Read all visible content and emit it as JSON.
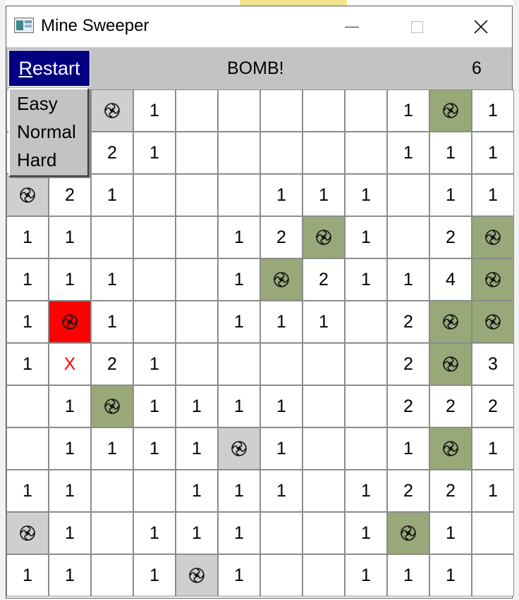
{
  "window": {
    "title": "Mine Sweeper"
  },
  "toolbar": {
    "restart_rest": "estart",
    "restart_accel": "R",
    "status": "BOMB!",
    "counter": "6"
  },
  "menu": {
    "items": [
      "Easy",
      "Normal",
      "Hard"
    ]
  },
  "colors": {
    "toolbar_bg": "#c3c3c3",
    "restart_bg": "#000080",
    "flagged_mine_bg": "#98a878",
    "revealed_mine_bg": "#cfcfcf",
    "exploded_bg": "#ff0000",
    "wrong_flag_color": "#ff0000"
  },
  "legend": {
    "M": "mine (revealed)",
    "F": "mine (flagged)",
    "B": "exploded mine",
    "X": "wrong flag"
  },
  "board": [
    [
      "",
      "",
      "M",
      "1",
      "",
      "",
      "",
      "",
      "",
      "1",
      "F",
      "1"
    ],
    [
      "",
      "",
      "2",
      "1",
      "",
      "",
      "",
      "",
      "",
      "1",
      "1",
      "1"
    ],
    [
      "M",
      "2",
      "1",
      "",
      "",
      "",
      "1",
      "1",
      "1",
      "",
      "1",
      "1"
    ],
    [
      "1",
      "1",
      "",
      "",
      "",
      "1",
      "2",
      "F",
      "1",
      "",
      "2",
      "F"
    ],
    [
      "1",
      "1",
      "1",
      "",
      "",
      "1",
      "F",
      "2",
      "1",
      "1",
      "4",
      "F"
    ],
    [
      "1",
      "B",
      "1",
      "",
      "",
      "1",
      "1",
      "1",
      "",
      "2",
      "F",
      "F"
    ],
    [
      "1",
      "X",
      "2",
      "1",
      "",
      "",
      "",
      "",
      "",
      "2",
      "F",
      "3"
    ],
    [
      "",
      "1",
      "F",
      "1",
      "1",
      "1",
      "1",
      "",
      "",
      "2",
      "2",
      "2"
    ],
    [
      "",
      "1",
      "1",
      "1",
      "1",
      "M",
      "1",
      "",
      "",
      "1",
      "F",
      "1"
    ],
    [
      "1",
      "1",
      "",
      "",
      "1",
      "1",
      "1",
      "",
      "1",
      "2",
      "2",
      "1"
    ],
    [
      "M",
      "1",
      "",
      "1",
      "1",
      "1",
      "",
      "",
      "1",
      "F",
      "1",
      ""
    ],
    [
      "1",
      "1",
      "",
      "1",
      "M",
      "1",
      "",
      "",
      "1",
      "1",
      "1",
      ""
    ]
  ]
}
